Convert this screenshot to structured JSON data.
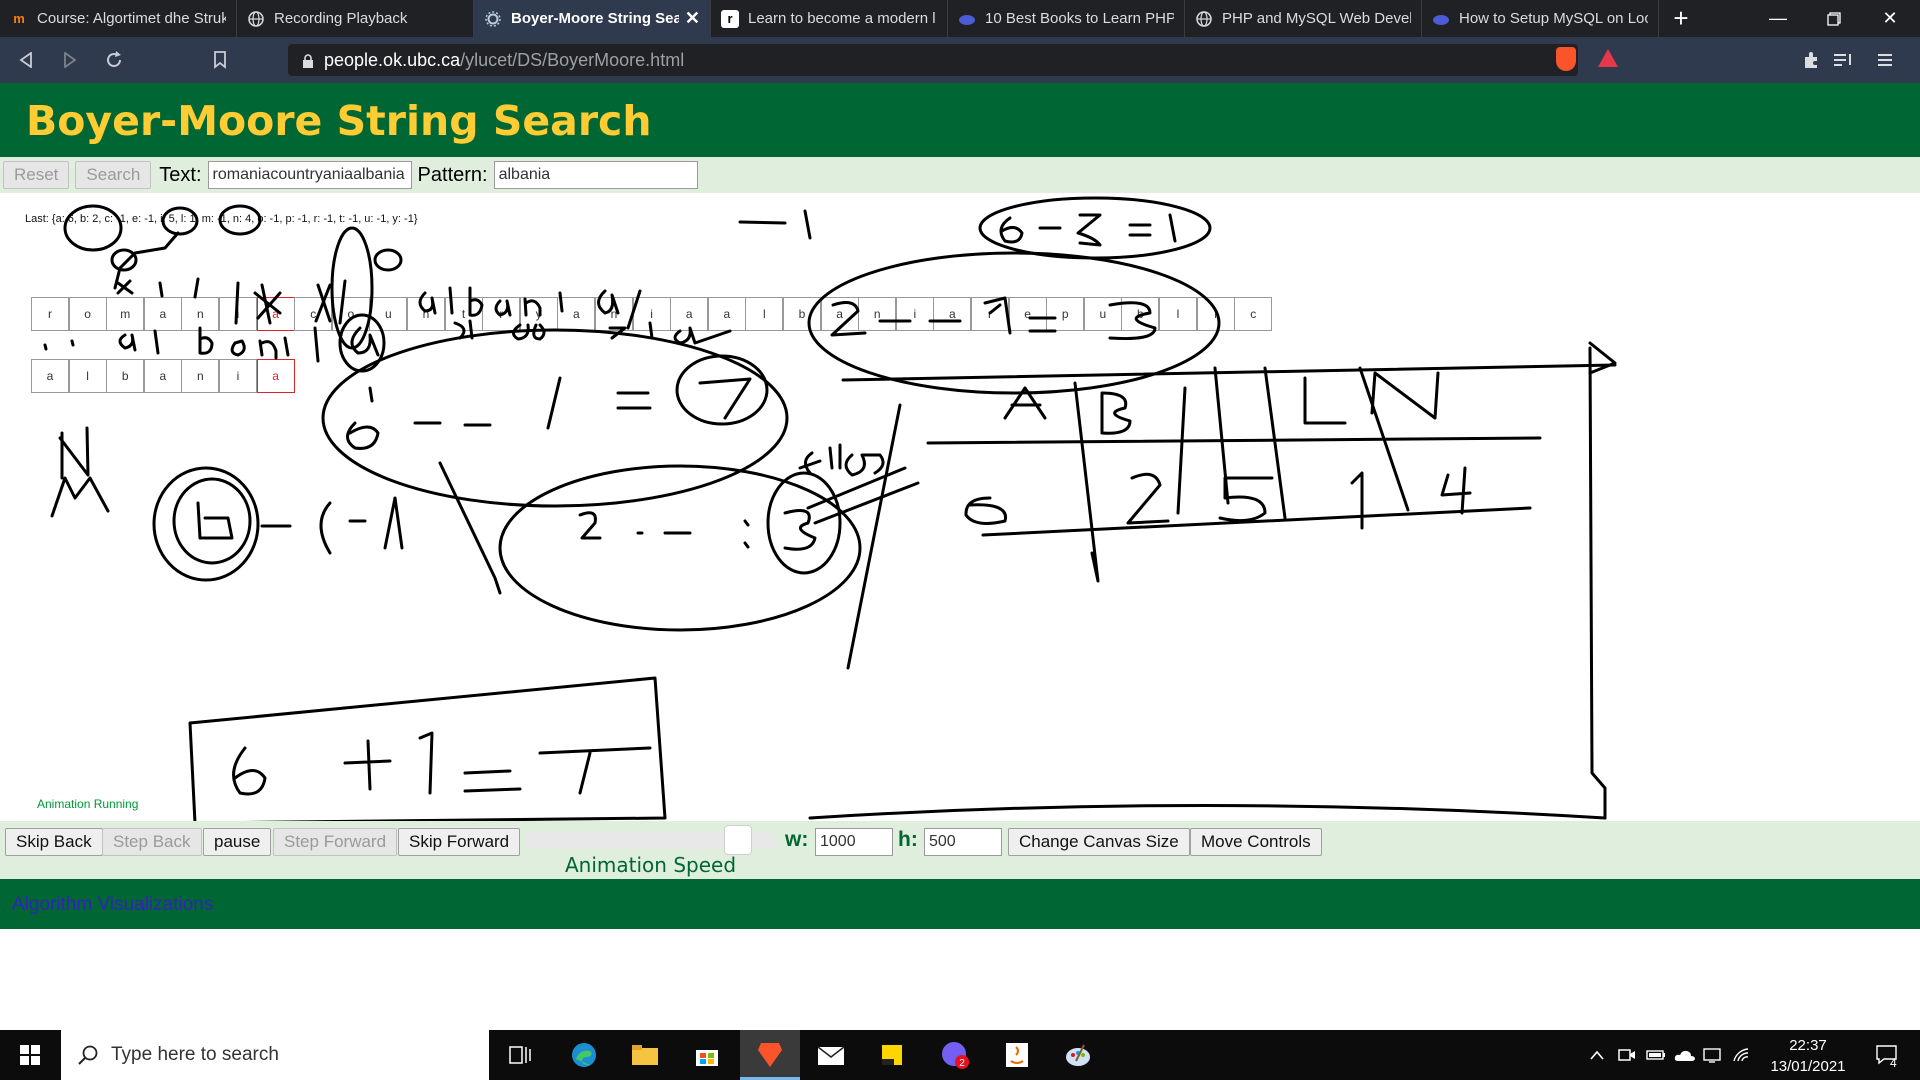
{
  "browser": {
    "tabs": [
      {
        "title": "Course: Algortimet dhe Struk",
        "icon": "moodle-icon",
        "active": false
      },
      {
        "title": "Recording Playback",
        "icon": "globe-icon",
        "active": false
      },
      {
        "title": "Boyer-Moore String Sea",
        "icon": "gear-icon",
        "active": true
      },
      {
        "title": "Learn to become a modern l",
        "icon": "roadmap-icon",
        "active": false
      },
      {
        "title": "10 Best Books to Learn PHP",
        "icon": "cloud-icon",
        "active": false
      },
      {
        "title": "PHP and MySQL Web Develo",
        "icon": "globe-icon",
        "active": false
      },
      {
        "title": "How to Setup MySQL on Loc",
        "icon": "cloud-icon",
        "active": false
      }
    ],
    "new_tab_label": "+",
    "url_host": "people.ok.ubc.ca",
    "url_path": "/ylucet/DS/BoyerMoore.html"
  },
  "page": {
    "title": "Boyer-Moore String Search",
    "top_controls": {
      "reset_label": "Reset",
      "search_label": "Search",
      "text_label": "Text:",
      "text_value": "romaniacountryaniaalbania",
      "pattern_label": "Pattern:",
      "pattern_value": "albania"
    },
    "canvas": {
      "last_table": "Last: {a: 6, b: 2, c: -1, e: -1, i: 5, l: 1, m: -1, n: 4, o: -1, p: -1, r: -1, t: -1, u: -1, y: -1}",
      "text_cells": [
        "r",
        "o",
        "m",
        "a",
        "n",
        "i",
        "a",
        "c",
        "o",
        "u",
        "n",
        "t",
        "r",
        "y",
        "a",
        "n",
        "i",
        "a",
        "a",
        "l",
        "b",
        "a",
        "n",
        "i",
        "a",
        "r",
        "e",
        "p",
        "u",
        "b",
        "l",
        "i",
        "c"
      ],
      "text_highlight_index": 6,
      "pattern_cells": [
        "a",
        "l",
        "b",
        "a",
        "n",
        "i",
        "a"
      ],
      "pattern_highlight_index": 6,
      "status": "Animation Running"
    },
    "bottom_controls": {
      "skip_back_label": "Skip Back",
      "step_back_label": "Step Back",
      "pause_label": "pause",
      "step_forward_label": "Step Forward",
      "skip_forward_label": "Skip Forward",
      "speed_label": "Animation Speed",
      "speed_fraction": 0.85,
      "w_label": "w:",
      "w_value": "1000",
      "h_label": "h:",
      "h_value": "500",
      "change_size_label": "Change Canvas Size",
      "move_controls_label": "Move Controls"
    },
    "footer_link": "Algorithm Visualizations"
  },
  "taskbar": {
    "search_placeholder": "Type here to search",
    "time": "22:37",
    "date": "13/01/2021",
    "notification_count": "4",
    "viber_badge": "2"
  },
  "colors": {
    "header_green": "#006633",
    "title_yellow": "#ffcc33",
    "control_bg": "#dfeedd",
    "highlight_red": "#e0202a"
  }
}
